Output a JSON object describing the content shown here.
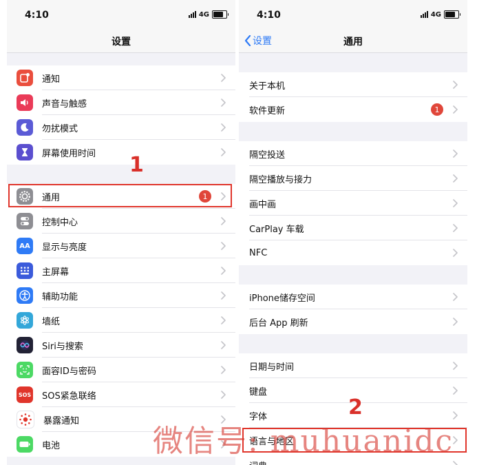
{
  "status_bar": {
    "time": "4:10",
    "network": "4G"
  },
  "left": {
    "title": "设置",
    "groups": [
      [
        {
          "label": "通知",
          "icon": "notification-icon",
          "color": "#ea4e3d"
        },
        {
          "label": "声音与触感",
          "icon": "speaker-icon",
          "color": "#ea3b58"
        },
        {
          "label": "勿扰模式",
          "icon": "moon-icon",
          "color": "#5b5bd6"
        },
        {
          "label": "屏幕使用时间",
          "icon": "hourglass-icon",
          "color": "#5b4fcf"
        }
      ],
      [
        {
          "label": "通用",
          "icon": "gear-icon",
          "color": "#8e8e93",
          "badge": "1"
        },
        {
          "label": "控制中心",
          "icon": "toggle-icon",
          "color": "#8e8e93"
        },
        {
          "label": "显示与亮度",
          "icon": "text-size-icon",
          "color": "#2f7bf6",
          "glyph": "AA"
        },
        {
          "label": "主屏幕",
          "icon": "home-grid-icon",
          "color": "#3b5bdb"
        },
        {
          "label": "辅助功能",
          "icon": "accessibility-icon",
          "color": "#2f7bf6"
        },
        {
          "label": "墙纸",
          "icon": "flower-icon",
          "color": "#33a7d9"
        },
        {
          "label": "Siri与搜索",
          "icon": "siri-icon",
          "color": "#222235"
        },
        {
          "label": "面容ID与密码",
          "icon": "face-id-icon",
          "color": "#4cd964"
        },
        {
          "label": "SOS紧急联络",
          "icon": "sos-icon",
          "color": "#e0352b",
          "glyph": "SOS"
        },
        {
          "label": "暴露通知",
          "icon": "exposure-icon",
          "color": "#ffffff"
        },
        {
          "label": "电池",
          "icon": "battery-icon",
          "color": "#4cd964"
        }
      ]
    ]
  },
  "right": {
    "back_label": "设置",
    "title": "通用",
    "groups": [
      [
        {
          "label": "关于本机"
        },
        {
          "label": "软件更新",
          "badge": "1"
        }
      ],
      [
        {
          "label": "隔空投送"
        },
        {
          "label": "隔空播放与接力"
        },
        {
          "label": "画中画"
        },
        {
          "label": "CarPlay 车载"
        },
        {
          "label": "NFC"
        }
      ],
      [
        {
          "label": "iPhone储存空间"
        },
        {
          "label": "后台 App 刷新"
        }
      ],
      [
        {
          "label": "日期与时间"
        },
        {
          "label": "键盘"
        },
        {
          "label": "字体"
        },
        {
          "label": "语言与地区"
        },
        {
          "label": "词典"
        }
      ]
    ]
  },
  "annotations": {
    "step1": "1",
    "step2": "2",
    "color": "#e0352b"
  },
  "watermark": "微信号: muhuanidc"
}
